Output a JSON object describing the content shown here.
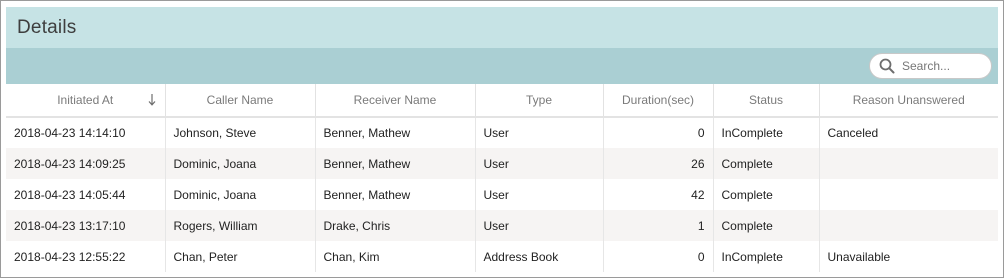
{
  "panel": {
    "title": "Details"
  },
  "search": {
    "placeholder": "Search..."
  },
  "table": {
    "columns": [
      "Initiated At",
      "Caller Name",
      "Receiver Name",
      "Type",
      "Duration(sec)",
      "Status",
      "Reason Unanswered"
    ],
    "sort_column": "Initiated At",
    "sort_direction": "descending",
    "rows": [
      [
        "2018-04-23 14:14:10",
        "Johnson, Steve",
        "Benner, Mathew",
        "User",
        "0",
        "InComplete",
        "Canceled"
      ],
      [
        "2018-04-23 14:09:25",
        "Dominic, Joana",
        "Benner, Mathew",
        "User",
        "26",
        "Complete",
        ""
      ],
      [
        "2018-04-23 14:05:44",
        "Dominic, Joana",
        "Benner, Mathew",
        "User",
        "42",
        "Complete",
        ""
      ],
      [
        "2018-04-23 13:17:10",
        "Rogers, William",
        "Drake, Chris",
        "User",
        "1",
        "Complete",
        ""
      ],
      [
        "2018-04-23 12:55:22",
        "Chan, Peter",
        "Chan, Kim",
        "Address Book",
        "0",
        "InComplete",
        "Unavailable"
      ]
    ]
  },
  "colors": {
    "title_bar": "#c6e3e5",
    "toolbar": "#aacfd3",
    "row_alt": "#f6f4f3"
  }
}
